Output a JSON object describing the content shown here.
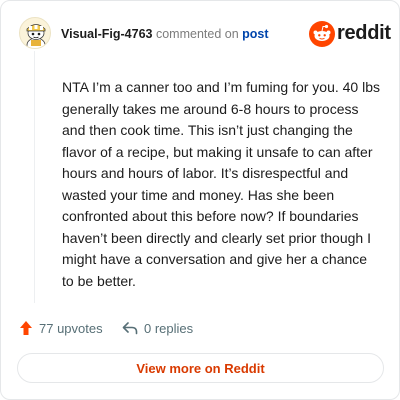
{
  "comment": {
    "username": "Visual-Fig-4763",
    "action_text": "commented on",
    "target_text": "post",
    "avatar_icon": "snoo-avatar-icon",
    "body": "NTA I’m a canner too and I’m fuming for you. 40 lbs generally takes me around 6-8 hours to process and then cook time. This isn’t just changing the flavor of a recipe, but making it unsafe to can after hours and hours of labor. It’s disrespectful and wasted your time and money. Has she been confronted about this before now? If boundaries haven’t been directly and clearly set prior though I might have a conversation and give her a chance to be better."
  },
  "brand": {
    "name": "reddit",
    "icon": "reddit-logo-icon",
    "color": "#ff4500"
  },
  "stats": {
    "upvotes": "77 upvotes",
    "upvote_icon": "upvote-arrow-icon",
    "upvote_color": "#ff4500",
    "replies": "0 replies",
    "reply_icon": "reply-arrow-icon"
  },
  "footer": {
    "view_more_label": "View more on Reddit",
    "accent": "#d93a00"
  }
}
